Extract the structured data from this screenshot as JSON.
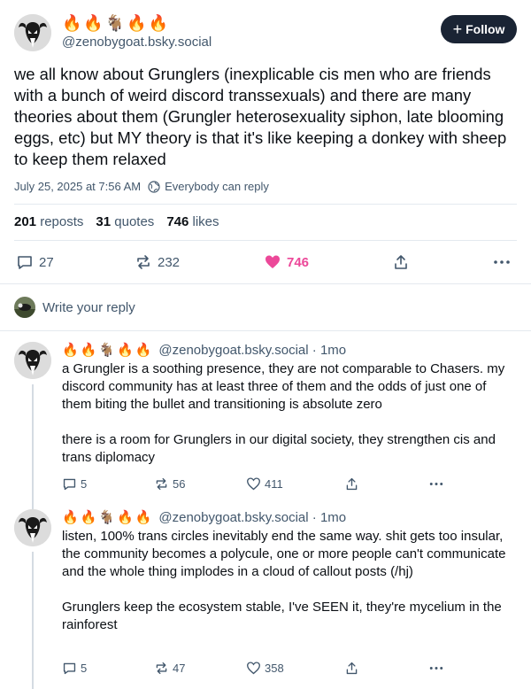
{
  "post": {
    "display_name": "🔥🔥🐐🔥🔥",
    "handle": "@zenobygoat.bsky.social",
    "follow_label": "Follow",
    "text": "we all know about Grunglers (inexplicable cis men who are friends with a bunch of weird discord transsexuals) and there are many theories about them (Grungler heterosexuality siphon, late blooming eggs, etc) but MY theory is that it's like keeping a donkey with sheep to keep them relaxed",
    "timestamp": "July 25, 2025 at 7:56 AM",
    "reply_setting": "Everybody can reply",
    "stats": {
      "reposts_count": "201",
      "reposts_label": "reposts",
      "quotes_count": "31",
      "quotes_label": "quotes",
      "likes_count": "746",
      "likes_label": "likes"
    },
    "actions": {
      "replies": "27",
      "reposts": "232",
      "likes": "746"
    },
    "colors": {
      "liked": "#ec4899",
      "follow_bg": "#1a2434"
    }
  },
  "reply_composer": {
    "placeholder": "Write your reply"
  },
  "replies": [
    {
      "display_name": "🔥🔥🐐🔥🔥",
      "handle": "@zenobygoat.bsky.social",
      "age": "· 1mo",
      "text": "a Grungler is a soothing presence, they are not comparable to Chasers. my discord community has at least three of them and the odds of just one of them biting the bullet and transitioning is absolute zero\n\nthere is a room for Grunglers in our digital society, they strengthen cis and trans diplomacy",
      "replies": "5",
      "reposts": "56",
      "likes": "411"
    },
    {
      "display_name": "🔥🔥🐐🔥🔥",
      "handle": "@zenobygoat.bsky.social",
      "age": "· 1mo",
      "text": "listen, 100% trans circles inevitably end the same way. shit gets too insular, the community becomes a polycule, one or more people can't communicate and the whole thing implodes in a cloud of callout posts (/hj)\n\nGrunglers keep the ecosystem stable, I've SEEN it, they're mycelium in the rainforest",
      "replies": "5",
      "reposts": "47",
      "likes": "358"
    }
  ]
}
